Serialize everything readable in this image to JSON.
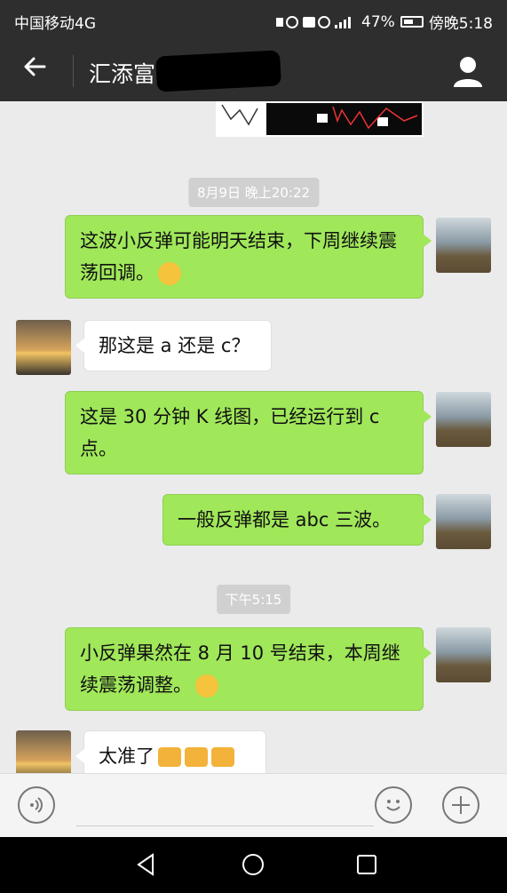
{
  "status": {
    "carrier": "中国移动4G",
    "battery": "47%",
    "time": "傍晚5:18"
  },
  "header": {
    "title": "汇添富"
  },
  "messages": {
    "time1": "8月9日 晚上20:22",
    "m1": "这波小反弹可能明天结束，下周继续震荡回调。",
    "m2": "那这是 a 还是 c？",
    "m3": "这是 30 分钟 K 线图，已经运行到 c 点。",
    "m4": "一般反弹都是 abc 三波。",
    "time2": "下午5:15",
    "m5": "小反弹果然在 8 月 10 号结束，本周继续震荡调整。",
    "m6": "太准了"
  },
  "icons": {
    "back": "arrow-left-icon",
    "profile": "person-icon",
    "voice": "voice-icon",
    "emoji": "emoji-icon",
    "add": "plus-icon"
  }
}
